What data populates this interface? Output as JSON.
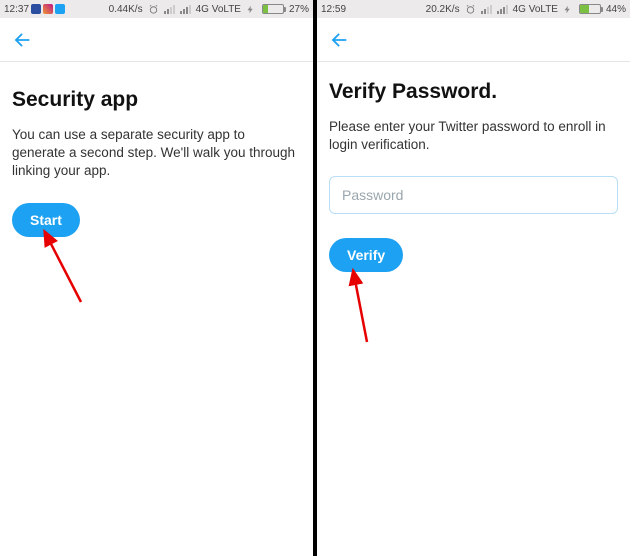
{
  "left": {
    "status": {
      "time": "12:37",
      "speed": "0.44K/s",
      "network": "4G VoLTE",
      "battery_pct": "27%",
      "battery_fill": "27%"
    },
    "title": "Security app",
    "desc": "You can use a separate security app to generate a second step. We'll walk you through linking your app.",
    "button": "Start"
  },
  "right": {
    "status": {
      "time": "12:59",
      "speed": "20.2K/s",
      "network": "4G VoLTE",
      "battery_pct": "44%",
      "battery_fill": "44%"
    },
    "title": "Verify Password.",
    "desc": "Please enter your Twitter password to enroll in login verification.",
    "placeholder": "Password",
    "button": "Verify"
  }
}
